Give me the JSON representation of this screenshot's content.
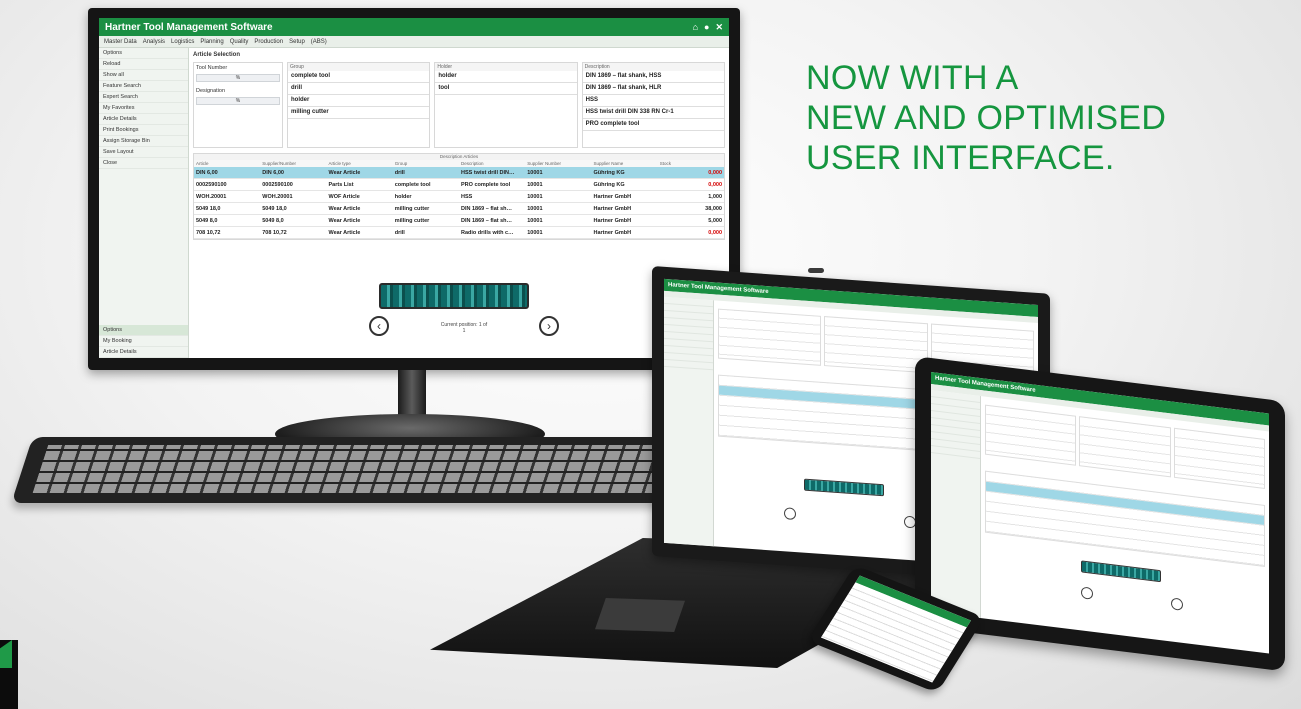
{
  "headline": {
    "line1": "NOW WITH A",
    "line2": "NEW AND OPTIMISED",
    "line3": "USER INTERFACE."
  },
  "desktop": {
    "title": "Hartner Tool Management Software",
    "title_icons": [
      "home-icon",
      "user-icon",
      "close-icon"
    ],
    "menu": [
      "Master Data",
      "Analysis",
      "Logistics",
      "Planning",
      "Quality",
      "Production",
      "Setup",
      "(ABS)"
    ],
    "sidebar": {
      "items": [
        "Options",
        "Reload",
        "Show all",
        "Feature Search",
        "Expert Search",
        "My Favorites",
        "Article Details",
        "Print Bookings",
        "Assign Storage Bin",
        "Save Layout",
        "Close"
      ],
      "bottom": [
        "Options",
        "My Booking",
        "Article Details"
      ]
    },
    "tab_label": "Article Selection",
    "left_fields": [
      "Tool Number",
      "Designation"
    ],
    "columns": [
      {
        "header": "Group",
        "cells": [
          "complete tool",
          "drill",
          "holder",
          "milling cutter"
        ]
      },
      {
        "header": "Holder",
        "cells": [
          "holder",
          "tool"
        ]
      },
      {
        "header": "Description",
        "cells": [
          "DIN 1869 – flat shank, HSS",
          "DIN 1869 – flat shank, HLR",
          "HSS",
          "HSS twist drill DIN 338 RN Cr-1",
          "PRO complete tool"
        ]
      }
    ],
    "results": {
      "band": "Description Articles",
      "headers": [
        "Article",
        "Supplier/Number",
        "Article type",
        "Group",
        "Description",
        "Supplier Number",
        "Supplier Name",
        "Stock"
      ],
      "rows": [
        [
          "DIN 6,00",
          "DIN 6,00",
          "Wear Article",
          "drill",
          "HSS twist drill DIN…",
          "10001",
          "Gühring KG",
          "0,000"
        ],
        [
          "0002590100",
          "0002590100",
          "Parts List",
          "complete tool",
          "PRO complete tool",
          "10001",
          "Gühring KG",
          "0,000"
        ],
        [
          "WOH.20001",
          "WOH.20001",
          "WOF Article",
          "holder",
          "HSS",
          "10001",
          "Hartner GmbH",
          "1,000"
        ],
        [
          "5049 18,0",
          "5049 18,0",
          "Wear Article",
          "milling cutter",
          "DIN 1869 – flat sh…",
          "10001",
          "Hartner GmbH",
          "38,000"
        ],
        [
          "5049 8,0",
          "5049 8,0",
          "Wear Article",
          "milling cutter",
          "DIN 1869 – flat sh…",
          "10001",
          "Hartner GmbH",
          "5,000"
        ],
        [
          "708 10,72",
          "708 10,72",
          "Wear Article",
          "drill",
          "Radio drills with c…",
          "10001",
          "Hartner GmbH",
          "0,000"
        ]
      ],
      "stock_status": [
        "red",
        "red",
        "normal",
        "normal",
        "normal",
        "red"
      ]
    },
    "preview_caption": "Current position: 1 of 1",
    "nav_prev": "‹",
    "nav_next": "›"
  },
  "devices": {
    "laptop_title": "Hartner Tool Management Software",
    "tablet_title": "Hartner Tool Management Software"
  },
  "colors": {
    "brand_green": "#1b8f43",
    "headline_green": "#15963f",
    "selected_row": "#9fd7e6",
    "stock_red": "#d40000"
  }
}
